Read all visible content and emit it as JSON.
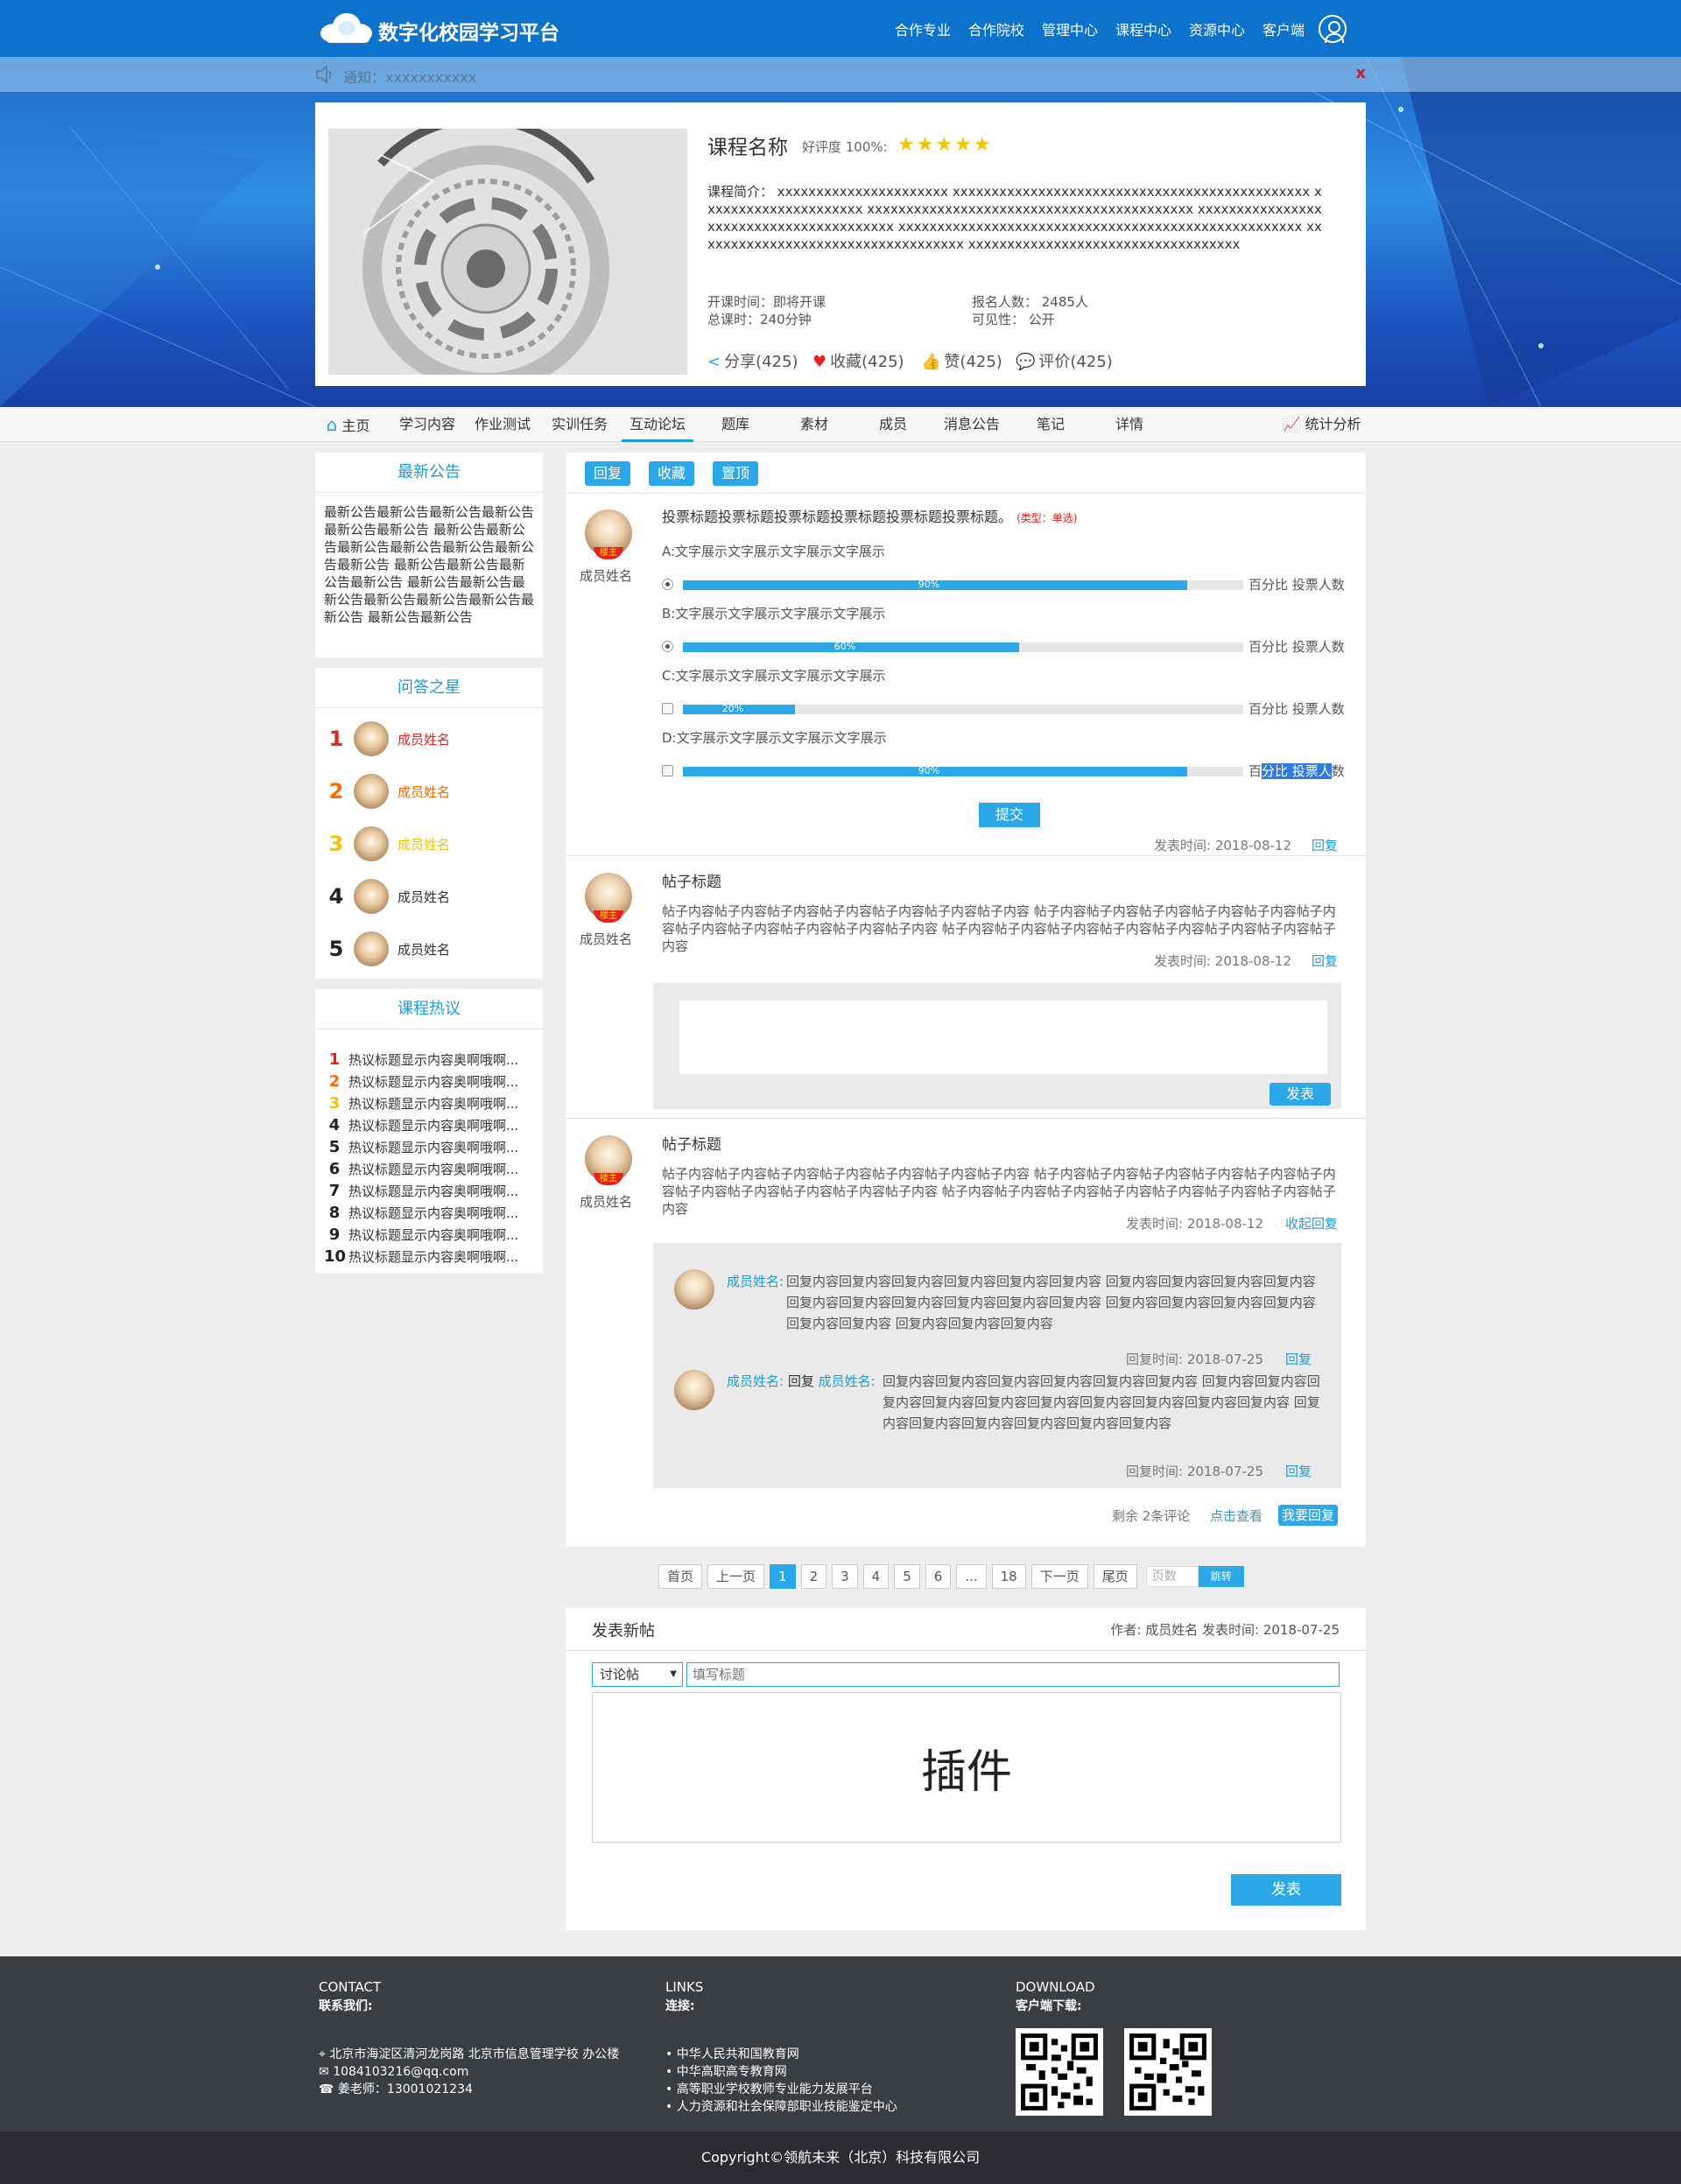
{
  "header": {
    "site_title": "数字化校园学习平台",
    "nav": [
      "合作专业",
      "合作院校",
      "管理中心",
      "课程中心",
      "资源中心",
      "客户端"
    ]
  },
  "notice": {
    "text": "通知：xxxxxxxxxxx",
    "close": "x"
  },
  "course": {
    "name": "课程名称",
    "rating_label": "好评度 100%:",
    "stars": "★★★★★",
    "intro": "课程简介： xxxxxxxxxxxxxxxxxxxxxx xxxxxxxxxxxxxxxxxxxxxxxxxxxxxxxxxxxxxxxxxxxxxx xxxxxxxxxxxxxxxxxxxxx xxxxxxxxxxxxxxxxxxxxxxxxxxxxxxxxxxxxxxxxxx xxxxxxxxxxxxxxxxxxxxxxxxxxxxxxxxxxxxxxxx xxxxxxxxxxxxxxxxxxxxxxxxxxxxxxxxxxxxxxxxxxxxxxxxxxxx xxxxxxxxxxxxxxxxxxxxxxxxxxxxxxxxxxx xxxxxxxxxxxxxxxxxxxxxxxxxxxxxxxxxxx",
    "start_time": "开课时间：即将开课",
    "total_hours": "总课时：240分钟",
    "enrolled": "报名人数： 2485人",
    "visibility": "可见性： 公开",
    "share": "分享(425)",
    "favorite": "收藏(425)",
    "like": "赞(425)",
    "comment": "评价(425)"
  },
  "subnav": {
    "items": [
      "主页",
      "学习内容",
      "作业测试",
      "实训任务",
      "互动论坛",
      "题库",
      "素材",
      "成员",
      "消息公告",
      "笔记",
      "详情"
    ],
    "stats": "统计分析"
  },
  "sidebar": {
    "announce_title": "最新公告",
    "announce_text": "最新公告最新公告最新公告最新公告最新公告最新公告 最新公告最新公告最新公告最新公告最新公告最新公告最新公告 最新公告最新公告最新公告最新公告 最新公告最新公告最新公告最新公告最新公告最新公告最新公告 最新公告最新公告",
    "stars_title": "问答之星",
    "stars": [
      {
        "rank": "1",
        "name": "成员姓名",
        "color": "#e4231f"
      },
      {
        "rank": "2",
        "name": "成员姓名",
        "color": "#ff6a00"
      },
      {
        "rank": "3",
        "name": "成员姓名",
        "color": "#f5c400"
      },
      {
        "rank": "4",
        "name": "成员姓名",
        "color": "#222222"
      },
      {
        "rank": "5",
        "name": "成员姓名",
        "color": "#222222"
      }
    ],
    "hot_title": "课程热议",
    "hot": [
      {
        "n": "1",
        "t": "热议标题显示内容奥啊哦啊..."
      },
      {
        "n": "2",
        "t": "热议标题显示内容奥啊哦啊..."
      },
      {
        "n": "3",
        "t": "热议标题显示内容奥啊哦啊..."
      },
      {
        "n": "4",
        "t": "热议标题显示内容奥啊哦啊..."
      },
      {
        "n": "5",
        "t": "热议标题显示内容奥啊哦啊..."
      },
      {
        "n": "6",
        "t": "热议标题显示内容奥啊哦啊..."
      },
      {
        "n": "7",
        "t": "热议标题显示内容奥啊哦啊..."
      },
      {
        "n": "8",
        "t": "热议标题显示内容奥啊哦啊..."
      },
      {
        "n": "9",
        "t": "热议标题显示内容奥啊哦啊..."
      },
      {
        "n": "10",
        "t": "热议标题显示内容奥啊哦啊..."
      }
    ],
    "hot_colors": [
      "#e4231f",
      "#ff6a00",
      "#f5c400",
      "#222222"
    ]
  },
  "toolbar": {
    "reply": "回复",
    "favorite": "收藏",
    "pin": "置顶"
  },
  "vote_post": {
    "author": "成员姓名",
    "author_tag": "楼主",
    "title": "投票标题投票标题投票标题投票标题投票标题投票标题。",
    "type": "(类型：单选)",
    "options": [
      {
        "label": "A:文字展示文字展示文字展示文字展示",
        "percent": 90,
        "pct_text": "90%",
        "right": "百分比 投票人数",
        "control": "radio",
        "checked": true
      },
      {
        "label": "B:文字展示文字展示文字展示文字展示",
        "percent": 60,
        "pct_text": "60%",
        "right": "百分比 投票人数",
        "control": "radio",
        "checked": true
      },
      {
        "label": "C:文字展示文字展示文字展示文字展示",
        "percent": 20,
        "pct_text": "20%",
        "right": "百分比 投票人数",
        "control": "checkbox",
        "checked": false
      },
      {
        "label": "D:文字展示文字展示文字展示文字展示",
        "percent": 90,
        "pct_text": "90%",
        "right_pre": "百",
        "right_hl": "分比 投票人",
        "right_post": "数",
        "control": "checkbox",
        "checked": false
      }
    ],
    "submit": "提交",
    "time": "发表时间: 2018-08-12",
    "reply": "回复"
  },
  "post2": {
    "author": "成员姓名",
    "author_tag": "楼主",
    "title": "帖子标题",
    "body": "帖子内容帖子内容帖子内容帖子内容帖子内容帖子内容帖子内容 帖子内容帖子内容帖子内容帖子内容帖子内容帖子内容帖子内容帖子内容帖子内容帖子内容帖子内容 帖子内容帖子内容帖子内容帖子内容帖子内容帖子内容帖子内容帖子内容",
    "time": "发表时间: 2018-08-12",
    "reply": "回复",
    "send": "发表"
  },
  "post3": {
    "author": "成员姓名",
    "author_tag": "楼主",
    "title": "帖子标题",
    "body": "帖子内容帖子内容帖子内容帖子内容帖子内容帖子内容帖子内容 帖子内容帖子内容帖子内容帖子内容帖子内容帖子内容帖子内容帖子内容帖子内容帖子内容帖子内容 帖子内容帖子内容帖子内容帖子内容帖子内容帖子内容帖子内容帖子内容",
    "time": "发表时间: 2018-08-12",
    "collapse": "收起回复",
    "replies": [
      {
        "name": "成员姓名:",
        "text": "回复内容回复内容回复内容回复内容回复内容回复内容 回复内容回复内容回复内容回复内容回复内容回复内容回复内容回复内容回复内容回复内容 回复内容回复内容回复内容回复内容回复内容回复内容 回复内容回复内容回复内容",
        "time": "回复时间: 2018-07-25",
        "reply": "回复"
      },
      {
        "name": "成员姓名:",
        "mid": "回复",
        "target": "成员姓名:",
        "text": "回复内容回复内容回复内容回复内容回复内容回复内容 回复内容回复内容回复内容回复内容回复内容回复内容回复内容回复内容回复内容回复内容 回复内容回复内容回复内容回复内容回复内容回复内容",
        "time": "回复时间: 2018-07-25",
        "reply": "回复"
      }
    ],
    "remaining": "剩余 2条评论",
    "view": "点击查看",
    "my_reply": "我要回复"
  },
  "pager": {
    "first": "首页",
    "prev": "上一页",
    "pages": [
      "1",
      "2",
      "3",
      "4",
      "5",
      "6",
      "...",
      "18"
    ],
    "next": "下一页",
    "last": "尾页",
    "input_placeholder": "页数",
    "jump": "跳转"
  },
  "new_post": {
    "title": "发表新帖",
    "meta": "作者: 成员姓名   发表时间: 2018-07-25",
    "select": "讨论帖",
    "input_placeholder": "填写标题",
    "editor": "插件",
    "submit": "发表"
  },
  "footer": {
    "contact_en": "CONTACT",
    "contact_cn": "联系我们:",
    "address": "北京市海淀区清河龙岗路 北京市信息管理学校 办公楼",
    "email": "1084103216@qq.com",
    "phone": "姜老师：13001021234",
    "links_en": "LINKS",
    "links_cn": "连接:",
    "links": [
      "中华人民共和国教育网",
      "中华高职高专教育网",
      "高等职业学校教师专业能力发展平台",
      "人力资源和社会保障部职业技能鉴定中心"
    ],
    "download_en": "DOWNLOAD",
    "download_cn": "客户端下载:",
    "copyright": "Copyright©领航未来（北京）科技有限公司"
  }
}
